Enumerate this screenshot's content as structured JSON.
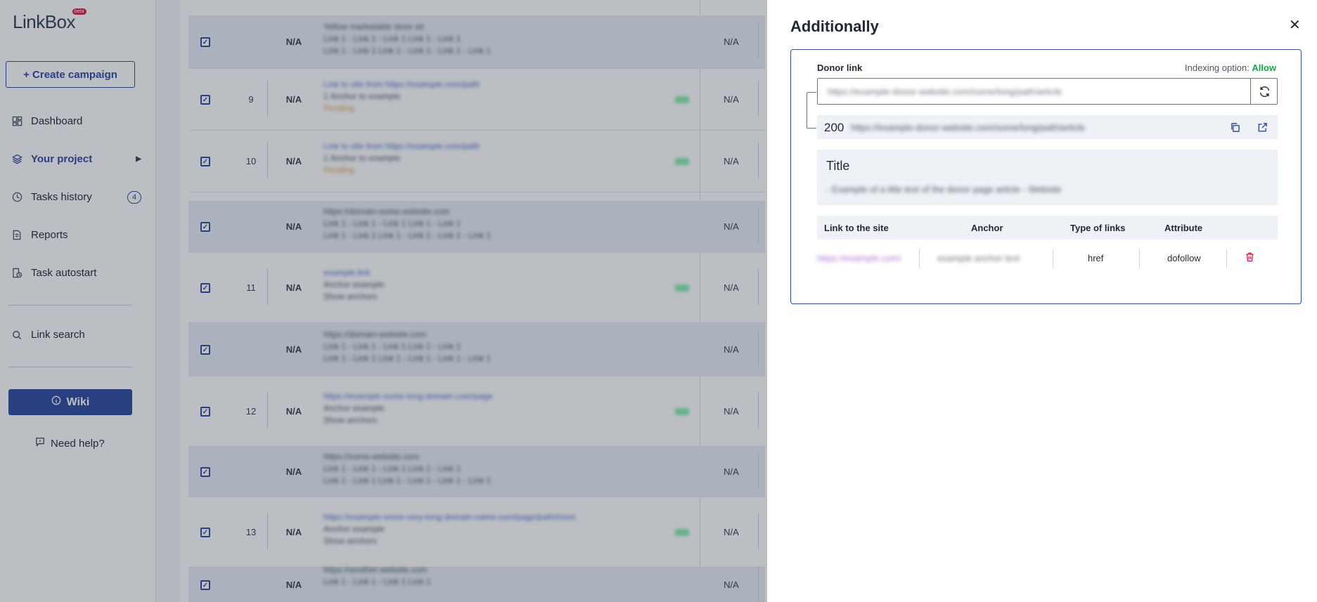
{
  "sidebar": {
    "logo": "LinkBox",
    "beta": "beta",
    "create_campaign": "+ Create campaign",
    "items": [
      {
        "label": "Dashboard",
        "icon": "dashboard-icon"
      },
      {
        "label": "Your project",
        "icon": "layers-icon"
      },
      {
        "label": "Tasks history",
        "icon": "clock-icon",
        "badge": "4"
      },
      {
        "label": "Reports",
        "icon": "report-icon"
      },
      {
        "label": "Task autostart",
        "icon": "autostart-icon"
      },
      {
        "label": "Link search",
        "icon": "search-icon"
      }
    ],
    "wiki": "Wiki",
    "help": "Need help?"
  },
  "table": {
    "na": "N/A",
    "rows": [
      {
        "num": "",
        "line1": "Yellow marketable store sit",
        "line2": "Link 1 - Link 1 - Link 1 Link 1 - Link 1",
        "line3": "Link 1 - Link 1 Link 1 - Link 1 - Link 1 - Link 1"
      },
      {
        "num": "9",
        "line1": "Link to site from https://example.com/path",
        "line2": "1 Anchor to example",
        "line3": "Pending"
      },
      {
        "num": "10",
        "line1": "Link to site from https://example.com/path",
        "line2": "1 Anchor to example",
        "line3": "Pending"
      },
      {
        "num": "",
        "line1": "https://domain-some-website.com",
        "line2": "Link 1 - Link 1 - Link 1 Link 1 - Link 1",
        "line3": "Link 1 - Link 1 Link 1 - Link 1 - Link 1 - Link 1"
      },
      {
        "num": "11",
        "line1": "example.link",
        "line2": "Anchor example",
        "line3": "Show anchors"
      },
      {
        "num": "",
        "line1": "https://domain-website.com",
        "line2": "Link 1 - Link 1 - Link 1 Link 1 - Link 1",
        "line3": "Link 1 - Link 1 Link 1 - Link 1 - Link 1 - Link 1"
      },
      {
        "num": "12",
        "line1": "https://example-some-long-domain.com/page",
        "line2": "Anchor example",
        "line3": "Show anchors"
      },
      {
        "num": "",
        "line1": "https://some-website.com",
        "line2": "Link 1 - Link 1 - Link 1 Link 1 - Link 1",
        "line3": "Link 1 - Link 1 Link 1 - Link 1 - Link 1 - Link 1"
      },
      {
        "num": "13",
        "line1": "https://example-some-very-long-domain-name.com/page/path/more",
        "line2": "Anchor example",
        "line3": "Show anchors"
      },
      {
        "num": "",
        "line1": "https://another-website.com",
        "line2": "Link 1 - Link 1 - Link 1 Link 1",
        "line3": ""
      }
    ]
  },
  "panel": {
    "title": "Additionally",
    "donor_label": "Donor link",
    "indexing_label": "Indexing option:",
    "indexing_value": "Allow",
    "donor_value": "https://example-donor-website.com/some/long/path/article",
    "status_code": "200",
    "status_url": "https://example-donor-website.com/some/long/path/article",
    "title_label": "Title",
    "title_value": "- Example of a title text of the donor page article - Website",
    "columns": {
      "link": "Link to the site",
      "anchor": "Anchor",
      "type": "Type of links",
      "attribute": "Attribute"
    },
    "row": {
      "link": "https://example.com/",
      "anchor": "example anchor text",
      "type": "href",
      "attribute": "dofollow"
    }
  }
}
